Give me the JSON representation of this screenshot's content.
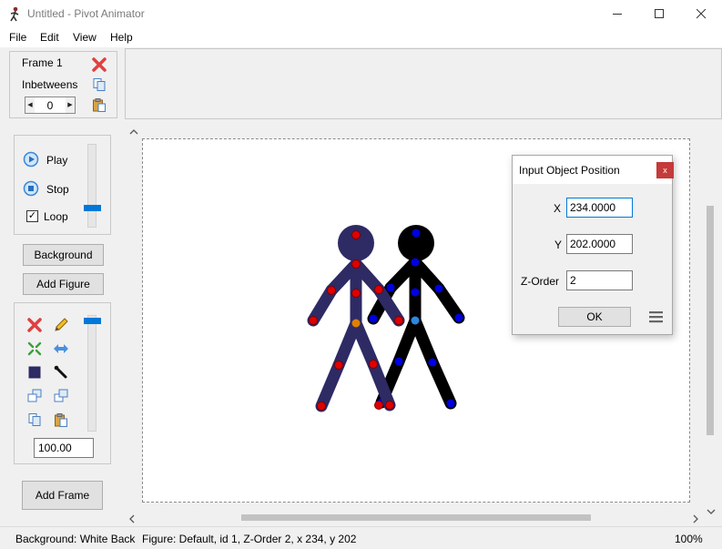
{
  "window": {
    "title": "Untitled - Pivot Animator"
  },
  "menu": [
    "File",
    "Edit",
    "View",
    "Help"
  ],
  "frame_panel": {
    "frame_label": "Frame 1",
    "inbetweens_label": "Inbetweens",
    "inbetweens_value": "0"
  },
  "playback": {
    "play_label": "Play",
    "stop_label": "Stop",
    "loop_label": "Loop",
    "loop_checked": true
  },
  "buttons": {
    "background": "Background",
    "add_figure": "Add Figure",
    "add_frame": "Add Frame"
  },
  "figure_tools": {
    "scale_value": "100.00",
    "icons": [
      "delete-figure-icon",
      "edit-figure-icon",
      "center-figure-icon",
      "flip-figure-icon",
      "color-icon",
      "segment-tool-icon",
      "send-back-icon",
      "bring-front-icon",
      "copy-figure-icon",
      "paste-figure-icon"
    ]
  },
  "dialog": {
    "title": "Input Object Position",
    "close_label": "x",
    "x_label": "X",
    "x_value": "234.0000",
    "y_label": "Y",
    "y_value": "202.0000",
    "z_label": "Z-Order",
    "z_value": "2",
    "ok_label": "OK"
  },
  "status": {
    "background": "Background: White Back",
    "figure": "Figure: Default,  id 1,  Z-Order 2,  x 234, y 202",
    "zoom": "100%"
  },
  "colors": {
    "figure_navy": "#2e2a64",
    "figure_black": "#000000",
    "joint_red": "#e00000",
    "joint_blue": "#0000e0",
    "joint_orange": "#e08000",
    "accent": "#0078d7"
  }
}
